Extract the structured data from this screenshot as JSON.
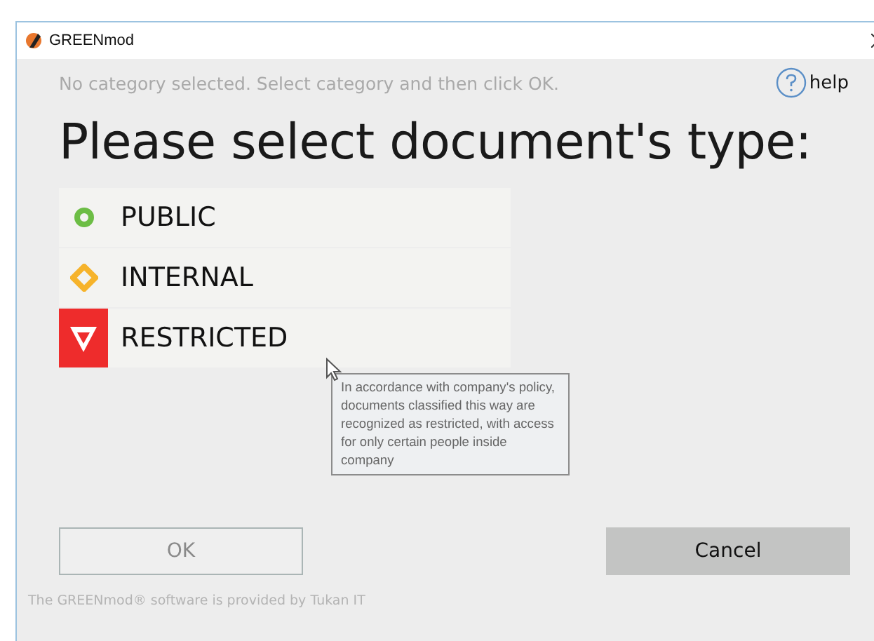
{
  "window": {
    "title": "GREENmod"
  },
  "hint": "No category selected. Select category and then click OK.",
  "help": {
    "label": "help"
  },
  "heading": "Please select document's type:",
  "categories": [
    {
      "kind": "public",
      "label": "PUBLIC",
      "selected": false
    },
    {
      "kind": "internal",
      "label": "INTERNAL",
      "selected": false
    },
    {
      "kind": "restricted",
      "label": "RESTRICTED",
      "selected": false
    }
  ],
  "tooltip": "In accordance with company's policy, documents classified this way are recognized as restricted, with access for only certain people inside company",
  "buttons": [
    {
      "kind": "ok",
      "label": "OK",
      "disabled": true
    },
    {
      "kind": "cancel",
      "label": "Cancel",
      "disabled": false
    }
  ],
  "footer": "The GREENmod® software is provided by Tukan IT"
}
